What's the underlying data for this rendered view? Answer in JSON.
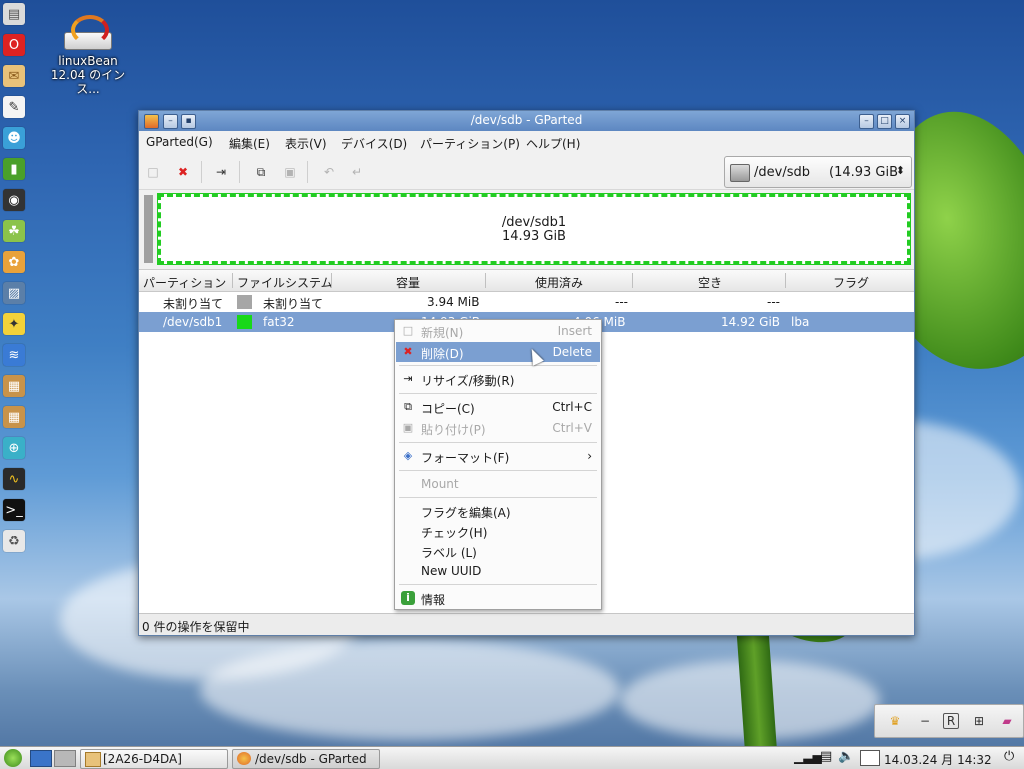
{
  "desktop": {
    "icon_label_line1": "linuxBean",
    "icon_label_line2": "12.04 のインス..."
  },
  "window": {
    "title": "/dev/sdb - GParted",
    "menu": [
      "GParted(G)",
      "編集(E)",
      "表示(V)",
      "デバイス(D)",
      "パーティション(P)",
      "ヘルプ(H)"
    ],
    "device_selector": {
      "device": "/dev/sdb",
      "size": "(14.93 GiB"
    },
    "map": {
      "name": "/dev/sdb1",
      "size": "14.93 GiB"
    },
    "table": {
      "headers": [
        "パーティション",
        "ファイルシステム",
        "容量",
        "使用済み",
        "空き",
        "フラグ"
      ],
      "rows": [
        {
          "partition": "未割り当て",
          "filesystem": "未割り当て",
          "fs_color": "#a6a6a6",
          "size": "3.94 MiB",
          "used": "---",
          "unused": "---",
          "flags": ""
        },
        {
          "partition": "/dev/sdb1",
          "filesystem": "fat32",
          "fs_color": "#18d818",
          "size": "14.93 GiB",
          "used": "4.06 MiB",
          "unused": "14.92 GiB",
          "flags": "lba"
        }
      ]
    },
    "status": "0 件の操作を保留中"
  },
  "context_menu": {
    "items": [
      {
        "label": "新規(N)",
        "accel": "Insert",
        "icon": "new-icon",
        "disabled": true
      },
      {
        "label": "削除(D)",
        "accel": "Delete",
        "icon": "delete-icon",
        "highlighted": true
      },
      {
        "label": "リサイズ/移動(R)",
        "accel": "",
        "icon": "resize-icon"
      },
      {
        "label": "コピー(C)",
        "accel": "Ctrl+C",
        "icon": "copy-icon"
      },
      {
        "label": "貼り付け(P)",
        "accel": "Ctrl+V",
        "icon": "paste-icon",
        "disabled": true
      },
      {
        "label": "フォーマット(F)",
        "accel": "",
        "icon": "format-icon",
        "submenu": true
      },
      {
        "label": "Mount",
        "accel": "",
        "icon": "",
        "disabled": true
      },
      {
        "label": "フラグを編集(A)",
        "accel": "",
        "icon": ""
      },
      {
        "label": "チェック(H)",
        "accel": "",
        "icon": ""
      },
      {
        "label": "ラベル (L)",
        "accel": "",
        "icon": ""
      },
      {
        "label": "New UUID",
        "accel": "",
        "icon": ""
      },
      {
        "label": "情報",
        "accel": "",
        "icon": "info-icon"
      }
    ]
  },
  "taskbar": {
    "tasks": [
      "[2A26-D4DA]",
      "/dev/sdb - GParted"
    ],
    "clock": "14.03.24 月 14:32"
  },
  "colors": {
    "selection": "#7b9fd1",
    "titlebar": "#6a93c9",
    "map_border": "#22cc22"
  }
}
